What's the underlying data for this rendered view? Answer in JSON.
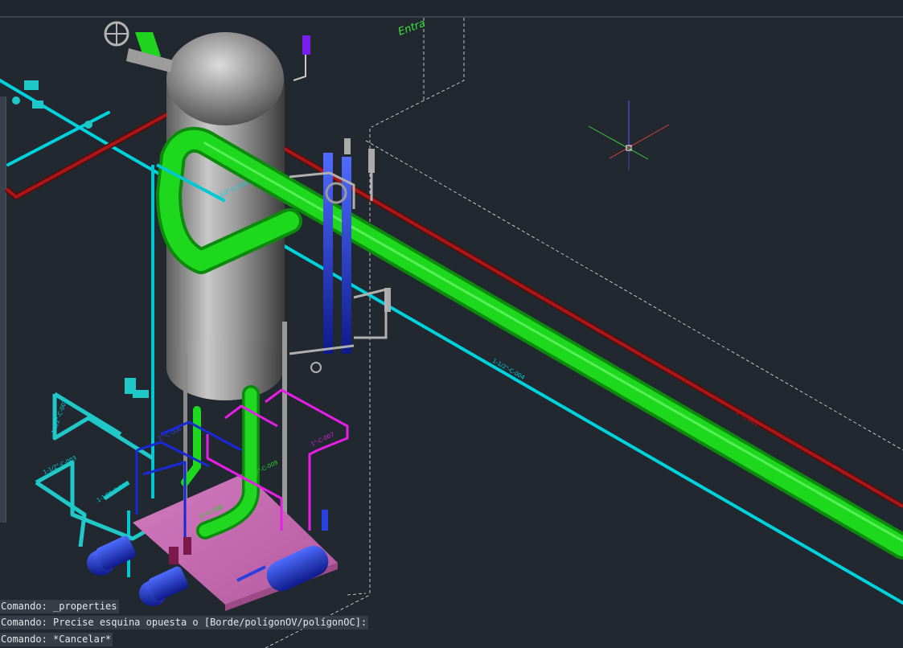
{
  "viewport_text": {
    "partial_view_label": "Entra",
    "pipe_tags": {
      "cyan_main": "1-1/2\"-C-004",
      "red_main": "2\"-C-001",
      "cyan_loop_vertical": "1-1/2\"-C-002",
      "cyan_loop_bottom": "1-1/2\"-C-003",
      "cyan_pump_line": "1-1/2\"-C-005",
      "blue_line": "1\"-C-006",
      "magenta_line": "1\"-C-007",
      "green_line": "6\"-C-008",
      "green_vertical": "6\"-C-009",
      "vessel_cyan": "1-1/2\"-C-010"
    }
  },
  "command_history": [
    "Comando: _properties",
    "Comando: Precise esquina opuesta o [Borde/polígonOV/polígonOC]:",
    "Comando: *Cancelar*"
  ],
  "colors": {
    "background": "#212830",
    "cyan_pipe": "#00d2dc",
    "green_pipe": "#14d414",
    "red_pipe": "#8c1414",
    "blue_equipment": "#1a32c8",
    "magenta_pipe": "#e61ee6",
    "base_pad": "#c868b4",
    "vessel_gray": "#8c8c8c",
    "ucs_x": "#e03c3c",
    "ucs_y": "#3cc83c",
    "ucs_z": "#5a5aff"
  },
  "icons": [
    "crosshair-cursor-icon",
    "valve-handwheel-icon",
    "pump-icon",
    "instrument-icon"
  ]
}
